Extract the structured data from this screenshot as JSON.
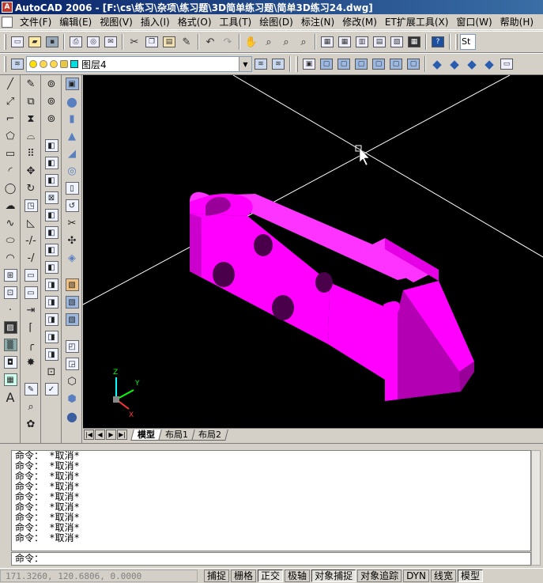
{
  "window": {
    "title": "AutoCAD 2006 - [F:\\cs\\练习\\杂项\\练习题\\3D简单练习题\\简单3D练习24.dwg]"
  },
  "menu": [
    "文件(F)",
    "编辑(E)",
    "视图(V)",
    "插入(I)",
    "格式(O)",
    "工具(T)",
    "绘图(D)",
    "标注(N)",
    "修改(M)",
    "ET扩展工具(X)",
    "窗口(W)",
    "帮助(H)"
  ],
  "toolbar_std": {
    "style_field": "St"
  },
  "layer": {
    "name": "图层4",
    "color": "#00e0e0"
  },
  "viewport": {
    "background": "#000000",
    "model_color": "#ff00ff",
    "ucs": {
      "x": "X",
      "y": "Y",
      "z": "Z"
    }
  },
  "tabs": [
    {
      "label": "模型",
      "active": true
    },
    {
      "label": "布局1",
      "active": false
    },
    {
      "label": "布局2",
      "active": false
    }
  ],
  "command": {
    "history": [
      "命令： *取消*",
      "命令： *取消*",
      "命令： *取消*",
      "命令： *取消*",
      "命令： *取消*",
      "命令： *取消*",
      "命令： *取消*",
      "命令： *取消*",
      "命令： *取消*"
    ],
    "prompt": "命令："
  },
  "status": {
    "coords": "171.3260, 120.6806, 0.0000",
    "buttons": [
      {
        "label": "捕捉",
        "on": false
      },
      {
        "label": "栅格",
        "on": false
      },
      {
        "label": "正交",
        "on": true
      },
      {
        "label": "极轴",
        "on": false
      },
      {
        "label": "对象捕捉",
        "on": true
      },
      {
        "label": "对象追踪",
        "on": false
      },
      {
        "label": "DYN",
        "on": false
      },
      {
        "label": "线宽",
        "on": false
      },
      {
        "label": "模型",
        "on": true
      }
    ]
  }
}
